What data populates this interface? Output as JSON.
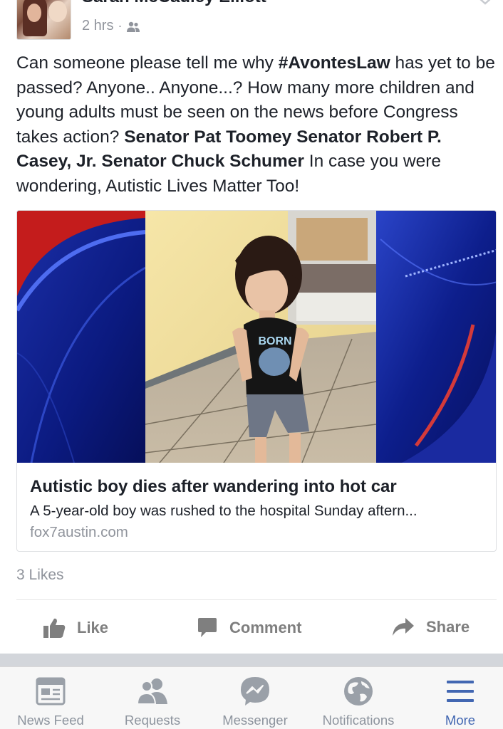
{
  "post": {
    "author": "Sarah McCauley Elliott",
    "time": "2 hrs",
    "separator": "·",
    "privacy_icon": "friends-icon",
    "text_segments": [
      {
        "text": "Can someone please tell me why ",
        "bold": false
      },
      {
        "text": "#AvontesLaw",
        "bold": true
      },
      {
        "text": " has yet to be passed? Anyone.. Anyone...? How many more children and young adults must be seen on the news before Congress takes action? ",
        "bold": false
      },
      {
        "text": "Senator Pat Toomey Senator Robert P. Casey, Jr. Senator Chuck Schumer",
        "bold": true
      },
      {
        "text": " In case you were wondering, Autistic Lives Matter Too!",
        "bold": false
      }
    ]
  },
  "link": {
    "title": "Autistic boy dies after wandering into hot car",
    "description": "A 5-year-old boy was rushed to the hospital Sunday aftern...",
    "domain": "fox7austin.com",
    "shirt_text": "BORN"
  },
  "likes": "3 Likes",
  "actions": {
    "like": "Like",
    "comment": "Comment",
    "share": "Share"
  },
  "tabbar": {
    "news_feed": "News Feed",
    "requests": "Requests",
    "messenger": "Messenger",
    "notifications": "Notifications",
    "more": "More"
  },
  "colors": {
    "accent": "#4267b2",
    "text": "#1d2129",
    "muted": "#90949c",
    "action_gray": "#7f7f7f"
  }
}
